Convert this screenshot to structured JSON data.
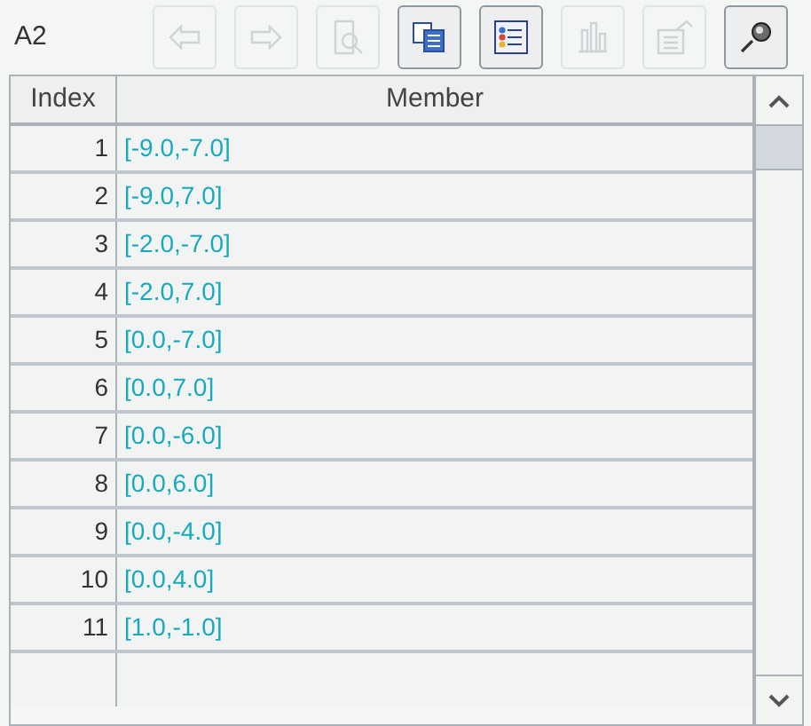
{
  "cell_ref": "A2",
  "toolbar": [
    {
      "kind": "back",
      "disabled": true
    },
    {
      "kind": "forward",
      "disabled": true
    },
    {
      "kind": "zoom",
      "disabled": true
    },
    {
      "kind": "copy",
      "disabled": false
    },
    {
      "kind": "list",
      "disabled": false
    },
    {
      "kind": "chart",
      "disabled": true
    },
    {
      "kind": "properties",
      "disabled": true
    },
    {
      "kind": "pin",
      "disabled": false
    }
  ],
  "table": {
    "columns": [
      "Index",
      "Member"
    ],
    "rows": [
      [
        "1",
        "[-9.0,-7.0]"
      ],
      [
        "2",
        "[-9.0,7.0]"
      ],
      [
        "3",
        "[-2.0,-7.0]"
      ],
      [
        "4",
        "[-2.0,7.0]"
      ],
      [
        "5",
        "[0.0,-7.0]"
      ],
      [
        "6",
        "[0.0,7.0]"
      ],
      [
        "7",
        "[0.0,-6.0]"
      ],
      [
        "8",
        "[0.0,6.0]"
      ],
      [
        "9",
        "[0.0,-4.0]"
      ],
      [
        "10",
        "[0.0,4.0]"
      ],
      [
        "11",
        "[1.0,-1.0]"
      ]
    ]
  }
}
